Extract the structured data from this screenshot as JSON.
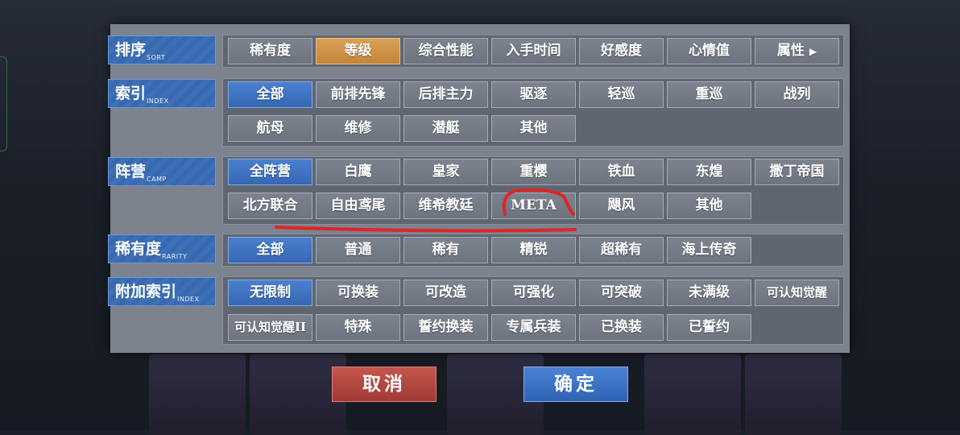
{
  "sections": {
    "sort": {
      "title": "排序",
      "sub": "SORT",
      "options": [
        "稀有度",
        "等级",
        "综合性能",
        "入手时间",
        "好感度",
        "心情值",
        "属性"
      ]
    },
    "index": {
      "title": "索引",
      "sub": "INDEX",
      "options": [
        "全部",
        "前排先锋",
        "后排主力",
        "驱逐",
        "轻巡",
        "重巡",
        "战列",
        "航母",
        "维修",
        "潜艇",
        "其他"
      ]
    },
    "camp": {
      "title": "阵营",
      "sub": "CAMP",
      "options": [
        "全阵营",
        "白鹰",
        "皇家",
        "重樱",
        "铁血",
        "东煌",
        "撒丁帝国",
        "北方联合",
        "自由鸢尾",
        "维希教廷",
        "META",
        "飓风",
        "其他"
      ]
    },
    "rarity": {
      "title": "稀有度",
      "sub": "RARITY",
      "options": [
        "全部",
        "普通",
        "稀有",
        "精锐",
        "超稀有",
        "海上传奇"
      ]
    },
    "extra": {
      "title": "附加索引",
      "sub": "INDEX",
      "options": [
        "无限制",
        "可换装",
        "可改造",
        "可强化",
        "可突破",
        "未满级",
        "可认知觉醒",
        "可认知觉醒II",
        "特殊",
        "誓约换装",
        "专属兵装",
        "已换装",
        "已誓约"
      ]
    }
  },
  "selected": {
    "sort": "等级",
    "index": "全部",
    "camp": "全阵营",
    "rarity": "全部",
    "extra": "无限制"
  },
  "actions": {
    "cancel": "取消",
    "confirm": "确定"
  },
  "icons": {
    "sort_more": "triangle-right-icon"
  },
  "colors": {
    "selected_blue": "#3e72c0",
    "selected_orange": "#c98a42",
    "cancel_red": "#b3463e",
    "confirm_blue": "#3a6fc0",
    "annotation_red": "#e02424"
  }
}
